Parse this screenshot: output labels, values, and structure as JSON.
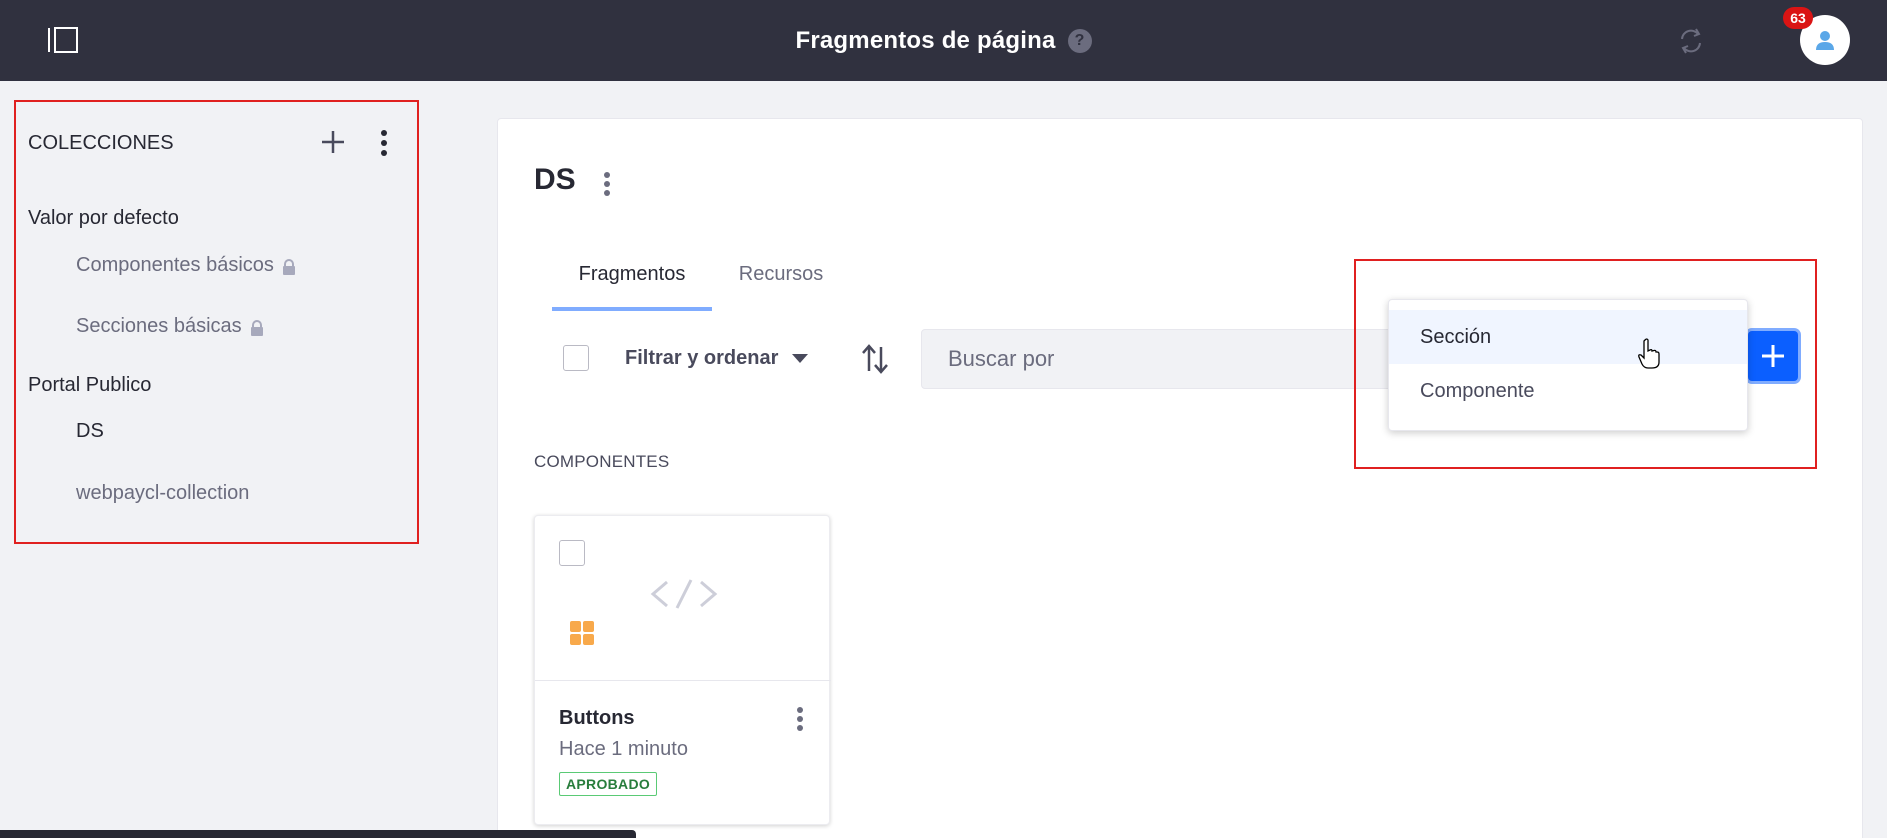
{
  "header": {
    "title": "Fragmentos de página",
    "help_icon": "?",
    "notification_count": "63"
  },
  "collections": {
    "title": "COLECCIONES",
    "groups": [
      {
        "label": "Valor por defecto",
        "items": [
          {
            "label": "Componentes básicos",
            "locked": true
          },
          {
            "label": "Secciones básicas",
            "locked": true
          }
        ]
      },
      {
        "label": "Portal Publico",
        "items": [
          {
            "label": "DS",
            "active": true
          },
          {
            "label": "webpaycl-collection"
          }
        ]
      }
    ]
  },
  "main": {
    "title": "DS",
    "tabs": [
      {
        "label": "Fragmentos",
        "active": true
      },
      {
        "label": "Recursos"
      }
    ],
    "toolbar": {
      "filter_label": "Filtrar y ordenar",
      "search_placeholder": "Buscar por"
    },
    "section_heading": "COMPONENTES",
    "fragments": [
      {
        "name": "Buttons",
        "modified": "Hace 1 minuto",
        "status": "APROBADO"
      }
    ],
    "add_menu": {
      "items": [
        {
          "label": "Sección",
          "hover": true
        },
        {
          "label": "Componente"
        }
      ]
    }
  },
  "colors": {
    "topbar": "#30313f",
    "primary": "#0b5fff",
    "highlight_border": "#e02020",
    "approved": "#287d3c"
  }
}
